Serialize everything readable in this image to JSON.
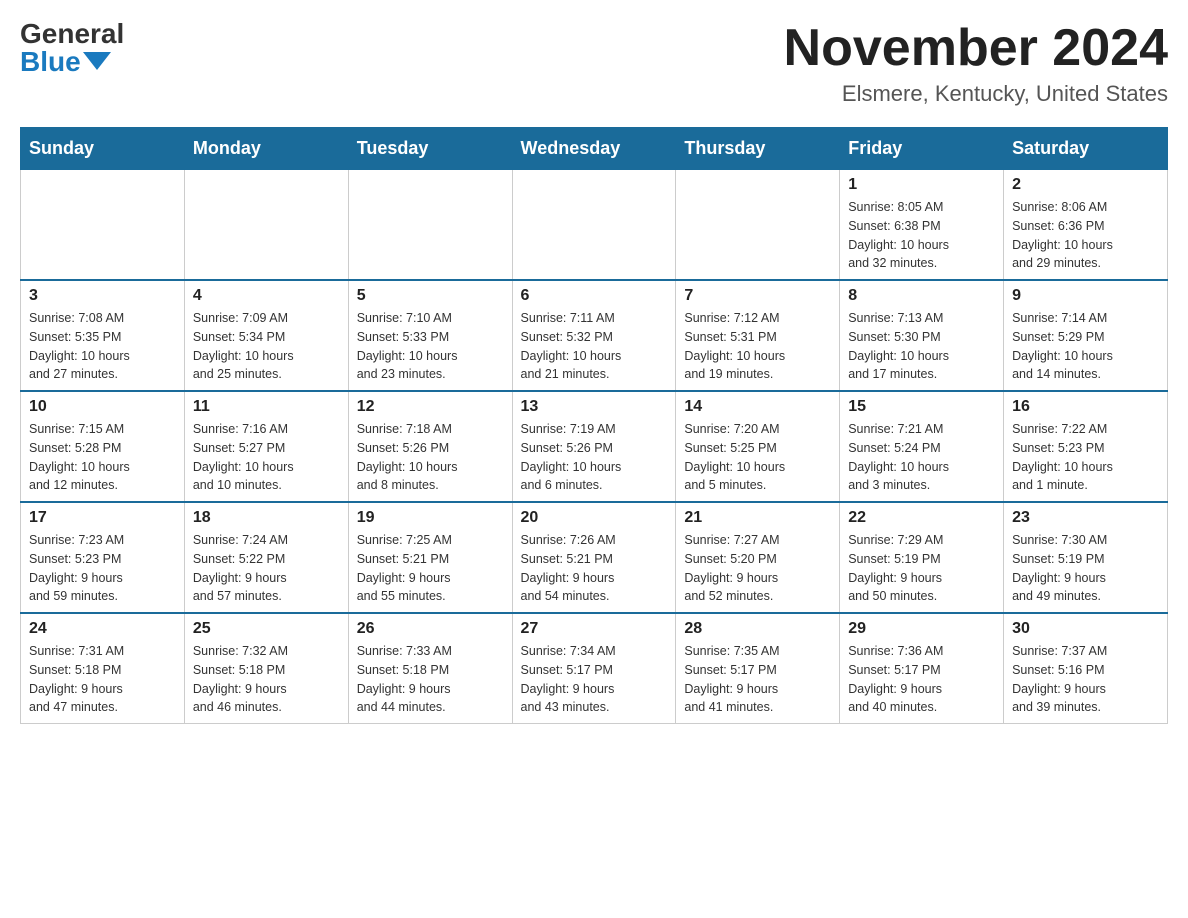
{
  "header": {
    "logo_general": "General",
    "logo_blue": "Blue",
    "month": "November 2024",
    "location": "Elsmere, Kentucky, United States"
  },
  "weekdays": [
    "Sunday",
    "Monday",
    "Tuesday",
    "Wednesday",
    "Thursday",
    "Friday",
    "Saturday"
  ],
  "rows": [
    [
      {
        "day": "",
        "info": ""
      },
      {
        "day": "",
        "info": ""
      },
      {
        "day": "",
        "info": ""
      },
      {
        "day": "",
        "info": ""
      },
      {
        "day": "",
        "info": ""
      },
      {
        "day": "1",
        "info": "Sunrise: 8:05 AM\nSunset: 6:38 PM\nDaylight: 10 hours\nand 32 minutes."
      },
      {
        "day": "2",
        "info": "Sunrise: 8:06 AM\nSunset: 6:36 PM\nDaylight: 10 hours\nand 29 minutes."
      }
    ],
    [
      {
        "day": "3",
        "info": "Sunrise: 7:08 AM\nSunset: 5:35 PM\nDaylight: 10 hours\nand 27 minutes."
      },
      {
        "day": "4",
        "info": "Sunrise: 7:09 AM\nSunset: 5:34 PM\nDaylight: 10 hours\nand 25 minutes."
      },
      {
        "day": "5",
        "info": "Sunrise: 7:10 AM\nSunset: 5:33 PM\nDaylight: 10 hours\nand 23 minutes."
      },
      {
        "day": "6",
        "info": "Sunrise: 7:11 AM\nSunset: 5:32 PM\nDaylight: 10 hours\nand 21 minutes."
      },
      {
        "day": "7",
        "info": "Sunrise: 7:12 AM\nSunset: 5:31 PM\nDaylight: 10 hours\nand 19 minutes."
      },
      {
        "day": "8",
        "info": "Sunrise: 7:13 AM\nSunset: 5:30 PM\nDaylight: 10 hours\nand 17 minutes."
      },
      {
        "day": "9",
        "info": "Sunrise: 7:14 AM\nSunset: 5:29 PM\nDaylight: 10 hours\nand 14 minutes."
      }
    ],
    [
      {
        "day": "10",
        "info": "Sunrise: 7:15 AM\nSunset: 5:28 PM\nDaylight: 10 hours\nand 12 minutes."
      },
      {
        "day": "11",
        "info": "Sunrise: 7:16 AM\nSunset: 5:27 PM\nDaylight: 10 hours\nand 10 minutes."
      },
      {
        "day": "12",
        "info": "Sunrise: 7:18 AM\nSunset: 5:26 PM\nDaylight: 10 hours\nand 8 minutes."
      },
      {
        "day": "13",
        "info": "Sunrise: 7:19 AM\nSunset: 5:26 PM\nDaylight: 10 hours\nand 6 minutes."
      },
      {
        "day": "14",
        "info": "Sunrise: 7:20 AM\nSunset: 5:25 PM\nDaylight: 10 hours\nand 5 minutes."
      },
      {
        "day": "15",
        "info": "Sunrise: 7:21 AM\nSunset: 5:24 PM\nDaylight: 10 hours\nand 3 minutes."
      },
      {
        "day": "16",
        "info": "Sunrise: 7:22 AM\nSunset: 5:23 PM\nDaylight: 10 hours\nand 1 minute."
      }
    ],
    [
      {
        "day": "17",
        "info": "Sunrise: 7:23 AM\nSunset: 5:23 PM\nDaylight: 9 hours\nand 59 minutes."
      },
      {
        "day": "18",
        "info": "Sunrise: 7:24 AM\nSunset: 5:22 PM\nDaylight: 9 hours\nand 57 minutes."
      },
      {
        "day": "19",
        "info": "Sunrise: 7:25 AM\nSunset: 5:21 PM\nDaylight: 9 hours\nand 55 minutes."
      },
      {
        "day": "20",
        "info": "Sunrise: 7:26 AM\nSunset: 5:21 PM\nDaylight: 9 hours\nand 54 minutes."
      },
      {
        "day": "21",
        "info": "Sunrise: 7:27 AM\nSunset: 5:20 PM\nDaylight: 9 hours\nand 52 minutes."
      },
      {
        "day": "22",
        "info": "Sunrise: 7:29 AM\nSunset: 5:19 PM\nDaylight: 9 hours\nand 50 minutes."
      },
      {
        "day": "23",
        "info": "Sunrise: 7:30 AM\nSunset: 5:19 PM\nDaylight: 9 hours\nand 49 minutes."
      }
    ],
    [
      {
        "day": "24",
        "info": "Sunrise: 7:31 AM\nSunset: 5:18 PM\nDaylight: 9 hours\nand 47 minutes."
      },
      {
        "day": "25",
        "info": "Sunrise: 7:32 AM\nSunset: 5:18 PM\nDaylight: 9 hours\nand 46 minutes."
      },
      {
        "day": "26",
        "info": "Sunrise: 7:33 AM\nSunset: 5:18 PM\nDaylight: 9 hours\nand 44 minutes."
      },
      {
        "day": "27",
        "info": "Sunrise: 7:34 AM\nSunset: 5:17 PM\nDaylight: 9 hours\nand 43 minutes."
      },
      {
        "day": "28",
        "info": "Sunrise: 7:35 AM\nSunset: 5:17 PM\nDaylight: 9 hours\nand 41 minutes."
      },
      {
        "day": "29",
        "info": "Sunrise: 7:36 AM\nSunset: 5:17 PM\nDaylight: 9 hours\nand 40 minutes."
      },
      {
        "day": "30",
        "info": "Sunrise: 7:37 AM\nSunset: 5:16 PM\nDaylight: 9 hours\nand 39 minutes."
      }
    ]
  ]
}
